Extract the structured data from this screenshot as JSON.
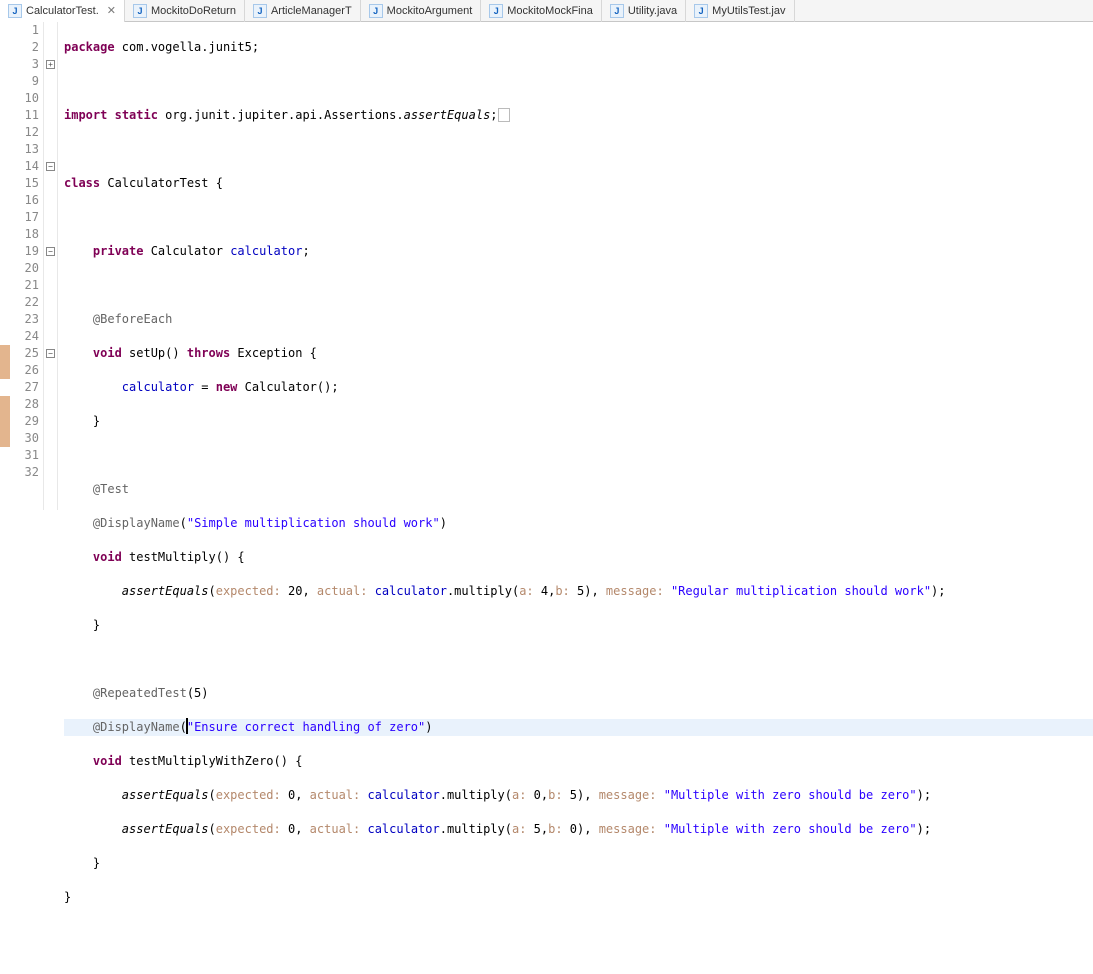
{
  "tabs": [
    {
      "label": "CalculatorTest.",
      "active": true,
      "closeable": true
    },
    {
      "label": "MockitoDoReturn",
      "active": false,
      "closeable": false
    },
    {
      "label": "ArticleManagerT",
      "active": false,
      "closeable": false
    },
    {
      "label": "MockitoArgument",
      "active": false,
      "closeable": false
    },
    {
      "label": "MockitoMockFina",
      "active": false,
      "closeable": false
    },
    {
      "label": "Utility.java",
      "active": false,
      "closeable": false
    },
    {
      "label": "MyUtilsTest.jav",
      "active": false,
      "closeable": false
    }
  ],
  "code": {
    "l1": {
      "kw1": "package",
      "rest": " com.vogella.junit5;"
    },
    "l3": {
      "kw1": "import",
      "kw2": "static",
      "rest": " org.junit.jupiter.api.Assertions.",
      "ital": "assertEquals",
      "semi": ";"
    },
    "l10": {
      "kw": "class",
      "name": " CalculatorTest {"
    },
    "l12": {
      "kw": "private",
      "type": " Calculator ",
      "field": "calculator",
      "semi": ";"
    },
    "l14": {
      "ann": "@BeforeEach"
    },
    "l15": {
      "kw": "void",
      "name": " setUp() ",
      "kw2": "throws",
      "rest": " Exception {"
    },
    "l16": {
      "field": "calculator",
      "eq": " = ",
      "kw": "new",
      "rest": " Calculator();"
    },
    "l17": {
      "text": "}"
    },
    "l19": {
      "ann": "@Test"
    },
    "l20": {
      "ann": "@DisplayName",
      "open": "(",
      "str": "\"Simple multiplication should work\"",
      "close": ")"
    },
    "l21": {
      "kw": "void",
      "name": " testMultiply() {"
    },
    "l22": {
      "call": "assertEquals",
      "open": "(",
      "h1": "expected: ",
      "v1": "20",
      "c1": ", ",
      "h2": "actual: ",
      "field": "calculator",
      "m": ".multiply(",
      "h3": "a: ",
      "v3": "4,",
      "h4": "b: ",
      "v4": "5)",
      "c2": ", ",
      "h5": "message: ",
      "str": "\"Regular multiplication should work\"",
      "close": ");"
    },
    "l23": {
      "text": "}"
    },
    "l25": {
      "ann": "@RepeatedTest",
      "open": "(5)"
    },
    "l26": {
      "ann": "@DisplayName",
      "open": "(",
      "str": "\"Ensure correct handling of zero\"",
      "close": ")"
    },
    "l27": {
      "kw": "void",
      "name": " testMultiplyWithZero() {"
    },
    "l28": {
      "call": "assertEquals",
      "open": "(",
      "h1": "expected: ",
      "v1": "0",
      "c1": ", ",
      "h2": "actual: ",
      "field": "calculator",
      "m": ".multiply(",
      "h3": "a: ",
      "v3": "0,",
      "h4": "b: ",
      "v4": "5)",
      "c2": ", ",
      "h5": "message: ",
      "str": "\"Multiple with zero should be zero\"",
      "close": ");"
    },
    "l29": {
      "call": "assertEquals",
      "open": "(",
      "h1": "expected: ",
      "v1": "0",
      "c1": ", ",
      "h2": "actual: ",
      "field": "calculator",
      "m": ".multiply(",
      "h3": "a: ",
      "v3": "5,",
      "h4": "b: ",
      "v4": "0)",
      "c2": ", ",
      "h5": "message: ",
      "str": "\"Multiple with zero should be zero\"",
      "close": ");"
    },
    "l30": {
      "text": "}"
    },
    "l31": {
      "text": "}"
    }
  },
  "glyphs": {
    "close": "✕",
    "fold_minus": "−",
    "fold_plus": "+"
  },
  "line_numbers": [
    "1",
    "2",
    "3",
    "9",
    "10",
    "11",
    "12",
    "13",
    "14",
    "15",
    "16",
    "17",
    "18",
    "19",
    "20",
    "21",
    "22",
    "23",
    "24",
    "25",
    "26",
    "27",
    "28",
    "29",
    "30",
    "31",
    "32"
  ]
}
